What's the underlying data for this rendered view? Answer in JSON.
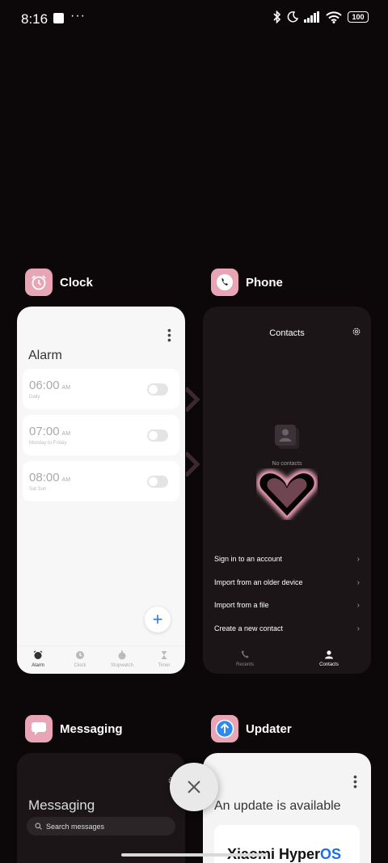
{
  "status_bar": {
    "time": "8:16",
    "more": "···",
    "battery": "100"
  },
  "apps": {
    "clock": {
      "name": "Clock",
      "title": "Alarm",
      "alarms": [
        {
          "time": "06:00",
          "ampm": "AM",
          "repeat": "Daily",
          "enabled": false
        },
        {
          "time": "07:00",
          "ampm": "AM",
          "repeat": "Monday to Friday",
          "enabled": false
        },
        {
          "time": "08:00",
          "ampm": "AM",
          "repeat": "Sat Sun",
          "enabled": false
        }
      ],
      "fab": "+",
      "tabs": [
        "Alarm",
        "Clock",
        "Stopwatch",
        "Timer"
      ]
    },
    "phone": {
      "name": "Phone",
      "title": "Contacts",
      "empty_text": "No contacts",
      "actions": [
        "Sign in to an account",
        "Import from an older device",
        "Import from a file",
        "Create a new contact"
      ],
      "tabs": [
        "Recents",
        "Contacts"
      ]
    },
    "messaging": {
      "name": "Messaging",
      "title": "Messaging",
      "search_placeholder": "Search messages"
    },
    "updater": {
      "name": "Updater",
      "title": "An update is available",
      "logo_brand": "Xiaomi Hyper",
      "logo_os": "OS"
    }
  },
  "close_button": "×",
  "colors": {
    "background": "#0c0809",
    "accent_pink": "#e7a5b5",
    "fab_blue": "#2b7ae0",
    "hyperos_blue": "#1d6cf0"
  }
}
